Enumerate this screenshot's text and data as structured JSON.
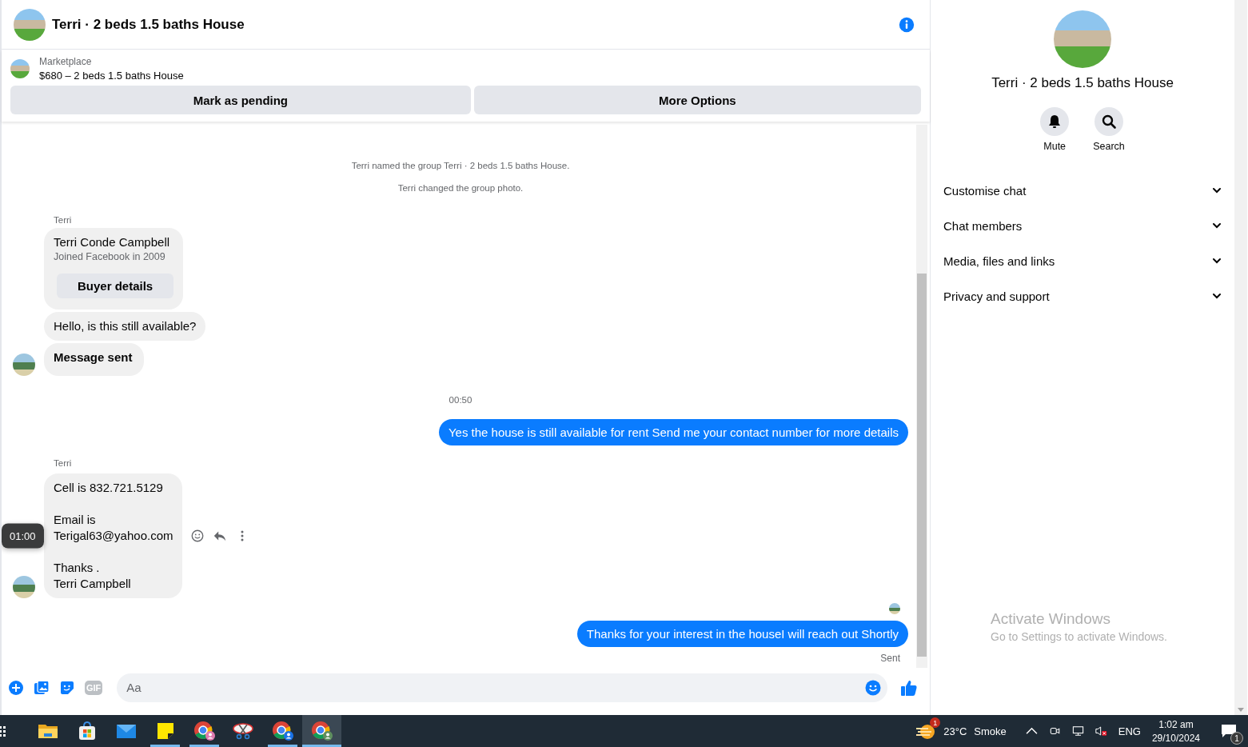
{
  "chat_header": {
    "title": "Terri · 2 beds 1.5 baths House"
  },
  "listing": {
    "source": "Marketplace",
    "summary": "$680 – 2 beds 1.5 baths House",
    "buttons": [
      "Mark as pending",
      "More Options"
    ]
  },
  "messages": [
    {
      "kind": "system",
      "text": "Terri named the group Terri · 2 beds 1.5 baths House."
    },
    {
      "kind": "system",
      "text": "Terri changed the group photo."
    },
    {
      "kind": "sender",
      "text": "Terri"
    },
    {
      "kind": "card",
      "title": "Terri Conde Campbell",
      "subtitle": "Joined Facebook in 2009",
      "button": "Buyer details"
    },
    {
      "kind": "incoming",
      "paragraphs": [
        [
          "Hello, is this still available?"
        ]
      ],
      "bold": false,
      "avatar": false,
      "hovered": false
    },
    {
      "kind": "incoming",
      "paragraphs": [
        [
          "Message sent"
        ]
      ],
      "bold": true,
      "avatar": true,
      "hovered": false
    },
    {
      "kind": "time",
      "text": "00:50"
    },
    {
      "kind": "outgoing",
      "text": "Yes the house is still available for rent Send me your contact number for more details"
    },
    {
      "kind": "sender",
      "text": "Terri"
    },
    {
      "kind": "incoming",
      "paragraphs": [
        [
          "Cell is 832.721.5129"
        ],
        [
          "Email is",
          "Terigal63@yahoo.com"
        ],
        [
          "Thanks .",
          "Terri Campbell"
        ]
      ],
      "bold": false,
      "avatar": true,
      "hovered": true,
      "tooltip": "01:00"
    },
    {
      "kind": "seen"
    },
    {
      "kind": "outgoing",
      "text": "Thanks for your interest in the houseI will reach out Shortly"
    },
    {
      "kind": "status",
      "text": "Sent"
    }
  ],
  "composer": {
    "gif_label": "GIF",
    "placeholder": "Aa"
  },
  "info_panel": {
    "title": "Terri · 2 beds 1.5 baths House",
    "actions": [
      {
        "kind": "mute",
        "label": "Mute"
      },
      {
        "kind": "search",
        "label": "Search"
      }
    ],
    "sections": [
      {
        "label": "Customise chat",
        "expanded": false
      },
      {
        "label": "Chat members",
        "expanded": false
      },
      {
        "label": "Media, files and links",
        "expanded": false
      },
      {
        "label": "Privacy and support",
        "expanded": false
      }
    ]
  },
  "activation_notice": {
    "title": "Activate Windows",
    "text": "Go to Settings to activate Windows."
  },
  "taskbar": {
    "apps": [
      {
        "kind": "explorer",
        "running": false,
        "active": false
      },
      {
        "kind": "store",
        "running": false,
        "active": false
      },
      {
        "kind": "mail",
        "running": false,
        "active": false
      },
      {
        "kind": "notes",
        "running": true,
        "active": false
      },
      {
        "kind": "chrome-person",
        "running": true,
        "active": false
      },
      {
        "kind": "snip",
        "running": false,
        "active": false
      },
      {
        "kind": "chrome-pc",
        "running": true,
        "active": false
      },
      {
        "kind": "chrome-green",
        "running": true,
        "active": true
      }
    ],
    "weather_badge": "1",
    "temperature": "23°C",
    "weather": "Smoke",
    "language": "ENG",
    "time": "1:02 am",
    "date": "29/10/2024",
    "notification_count": "1"
  }
}
